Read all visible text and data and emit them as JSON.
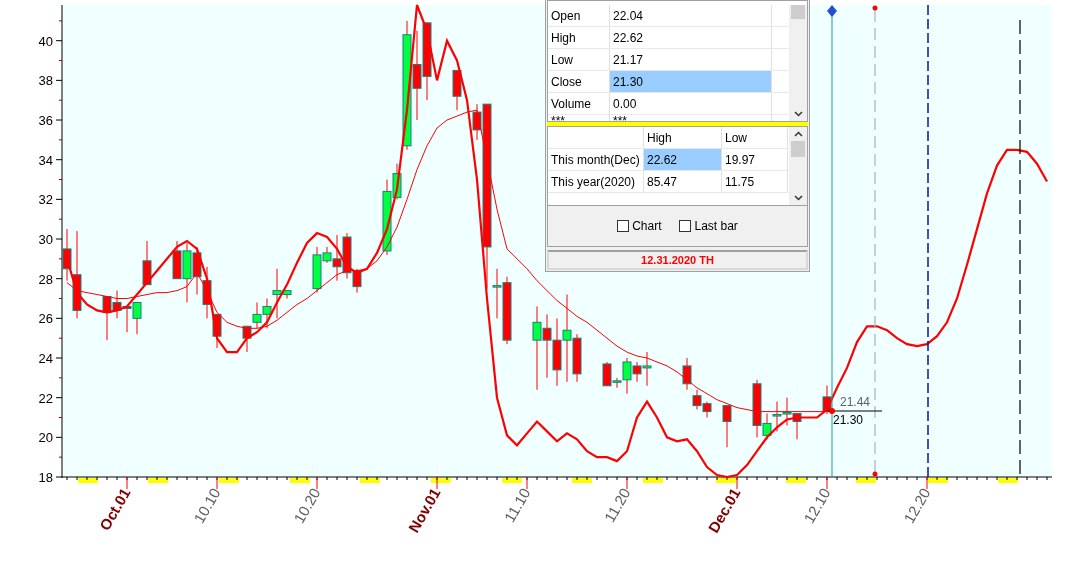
{
  "chart": {
    "chart_data": {
      "type": "candlestick",
      "ylim": [
        18,
        41.8
      ],
      "yticks": [
        18,
        20,
        22,
        24,
        26,
        28,
        30,
        32,
        34,
        36,
        38,
        40
      ],
      "categories": [
        null,
        null,
        null,
        null,
        null,
        null,
        "Oct.01",
        null,
        null,
        null,
        null,
        null,
        null,
        null,
        null,
        "10.10",
        null,
        null,
        null,
        null,
        null,
        null,
        null,
        null,
        null,
        "10.20",
        null,
        null,
        null,
        null,
        null,
        null,
        null,
        null,
        null,
        null,
        null,
        "Nov.01",
        null,
        null,
        null,
        null,
        null,
        null,
        null,
        null,
        "11.10",
        null,
        null,
        null,
        null,
        null,
        null,
        null,
        null,
        null,
        "11.20",
        null,
        null,
        null,
        null,
        null,
        null,
        null,
        null,
        null,
        null,
        "Dec.01",
        null,
        null,
        null,
        null,
        null,
        null,
        null,
        null,
        "12.10",
        null,
        null,
        null,
        null,
        null,
        null,
        null,
        null,
        null,
        "12.20",
        null,
        null,
        null,
        null,
        null,
        null,
        null,
        null,
        null,
        null,
        null,
        null
      ],
      "ohlc": [
        [
          29.5,
          30.5,
          27.9,
          28.5
        ],
        [
          28.2,
          30.4,
          26,
          26.4
        ],
        null,
        null,
        [
          27.1,
          27.1,
          24.9,
          26.3
        ],
        [
          26.8,
          27.4,
          26,
          26.4
        ],
        [
          26.6,
          26.6,
          25.3,
          26.5
        ],
        [
          26,
          26.8,
          25.2,
          26.8
        ],
        [
          28.9,
          29.9,
          27.7,
          27.7
        ],
        null,
        null,
        [
          29.4,
          29.9,
          28,
          28
        ],
        [
          28,
          29.8,
          26.8,
          29.4
        ],
        [
          29.3,
          29.6,
          27.2,
          28.1
        ],
        [
          27.9,
          28.6,
          26,
          26.7
        ],
        [
          26.2,
          26.2,
          24.5,
          25.1
        ],
        null,
        null,
        [
          25.6,
          25.6,
          24.3,
          25
        ],
        [
          25.8,
          26.8,
          25.5,
          26.2
        ],
        [
          26.2,
          27,
          25.5,
          26.6
        ],
        [
          27.2,
          28.5,
          26,
          27.4
        ],
        [
          27.2,
          27.4,
          27,
          27.4
        ],
        null,
        null,
        [
          27.5,
          29.6,
          27.3,
          29.2
        ],
        [
          28.9,
          29.6,
          28.8,
          29.3
        ],
        [
          29,
          30.2,
          27.9,
          28.6
        ],
        [
          30.1,
          30.3,
          28,
          28.3
        ],
        [
          28.4,
          28.5,
          27.3,
          27.6
        ],
        null,
        null,
        [
          29.4,
          33,
          29.2,
          32.4
        ],
        [
          32.1,
          33.8,
          32,
          33.3
        ],
        [
          34.7,
          41,
          34.5,
          40.3
        ],
        [
          38.8,
          40.5,
          36,
          37.6
        ],
        [
          40.9,
          40.9,
          37,
          38.2
        ],
        null,
        null,
        [
          38.5,
          38.5,
          36.5,
          37.2
        ],
        null,
        [
          36.4,
          36.8,
          35,
          35.5
        ],
        [
          36.8,
          36.8,
          27.5,
          29.6
        ],
        [
          27.6,
          28.5,
          26,
          27.65
        ],
        [
          27.8,
          28.1,
          24.7,
          24.9
        ],
        null,
        null,
        [
          24.9,
          26.6,
          22.4,
          25.8
        ],
        [
          25.5,
          26.2,
          23,
          24.9
        ],
        [
          24.9,
          26,
          22.6,
          23.4
        ],
        [
          24.9,
          27.2,
          22.8,
          25.4
        ],
        [
          25,
          25.2,
          22.8,
          23.2
        ],
        null,
        null,
        [
          23.7,
          23.8,
          22.6,
          22.6
        ],
        [
          22.8,
          23,
          22.5,
          22.85
        ],
        [
          22.9,
          24,
          22.2,
          23.8
        ],
        [
          23.6,
          23.8,
          22.8,
          23.2
        ],
        [
          23.5,
          24.3,
          22.6,
          23.6
        ],
        null,
        null,
        null,
        [
          23.6,
          24,
          22.4,
          22.7
        ],
        [
          22.1,
          22.4,
          21.4,
          21.6
        ],
        [
          21.7,
          21.8,
          21,
          21.3
        ],
        null,
        [
          21.6,
          21.6,
          19.5,
          20.8
        ],
        null,
        null,
        [
          22.7,
          22.9,
          20,
          20.6
        ],
        [
          20.1,
          21.2,
          19.9,
          20.7
        ],
        [
          21.1,
          21.8,
          20.3,
          21.15
        ],
        [
          21.2,
          22,
          20.6,
          21.25
        ],
        [
          21.2,
          21.2,
          19.9,
          20.8
        ],
        null,
        null,
        [
          22.04,
          22.62,
          21.17,
          21.3
        ],
        null,
        null,
        null,
        null,
        null,
        null,
        null,
        null,
        null,
        null,
        null,
        null,
        null,
        null,
        null,
        null,
        null,
        null,
        null,
        null,
        null,
        null
      ],
      "series": [
        {
          "type": "line",
          "color": "#ff0000",
          "values": [
            29.0,
            27.3,
            26.7,
            26.4,
            26.3,
            26.4,
            26.6,
            27.2,
            27.8,
            28.4,
            29.0,
            29.6,
            29.9,
            29.5,
            28.0,
            25.0,
            24.3,
            24.3,
            25.0,
            25.3,
            25.8,
            26.8,
            27.7,
            28.8,
            29.8,
            30.3,
            30.1,
            29.5,
            28.6,
            28.3,
            28.5,
            29.3,
            30.5,
            32.5,
            36.5,
            41.8,
            40.5,
            38.0,
            40.0,
            39.0,
            37.0,
            33.0,
            27.0,
            22.0,
            20.1,
            19.6,
            20.2,
            20.8,
            20.3,
            19.8,
            20.2,
            19.9,
            19.3,
            19.0,
            19.0,
            18.8,
            19.3,
            21.0,
            21.8,
            21.0,
            20.0,
            19.8,
            19.9,
            19.3,
            18.5,
            18.1,
            18.0,
            18.1,
            18.6,
            19.3,
            20.0,
            20.5,
            20.9,
            21.0,
            21.0,
            21.0,
            21.4,
            22.5,
            23.5,
            24.8,
            25.6,
            25.6,
            25.4,
            25.0,
            24.7,
            24.6,
            24.7,
            25.1,
            25.8,
            27.0,
            28.7,
            30.5,
            32.3,
            33.7,
            34.5,
            34.5,
            34.4,
            33.8,
            32.9
          ]
        },
        {
          "type": "line",
          "color": "#ff0000",
          "values": [
            27.8,
            27.4,
            27.3,
            27.2,
            27.1,
            27.0,
            27.0,
            27.1,
            27.2,
            27.3,
            27.3,
            27.4,
            27.6,
            28.3,
            27.4,
            26.3,
            25.8,
            25.6,
            25.5,
            25.5,
            25.6,
            25.9,
            26.3,
            26.7,
            27.0,
            27.4,
            27.8,
            28.2,
            28.4,
            28.4,
            28.5,
            28.9,
            29.6,
            30.6,
            32.0,
            33.5,
            34.7,
            35.6,
            36.0,
            36.2,
            36.4,
            36.5,
            34.0,
            31.5,
            29.5,
            29.0,
            28.5,
            27.9,
            27.4,
            26.9,
            26.5,
            26.1,
            25.8,
            25.4,
            25.0,
            24.6,
            24.3,
            24.1,
            24.0,
            23.8,
            23.6,
            23.3,
            22.9,
            22.5,
            22.2,
            21.9,
            21.7,
            21.5,
            21.4,
            21.3,
            21.3,
            21.3,
            21.3,
            21.3,
            21.3,
            21.3,
            21.3,
            null,
            null,
            null,
            null,
            null,
            null,
            null,
            null,
            null,
            null,
            null,
            null,
            null,
            null,
            null,
            null,
            null,
            null,
            null,
            null,
            null,
            null
          ]
        }
      ]
    },
    "x_label_styles": [
      {
        "emphasized": true
      },
      {
        "emphasized": false
      },
      {
        "emphasized": false
      },
      {
        "emphasized": true
      },
      {
        "emphasized": false
      },
      {
        "emphasized": false
      },
      {
        "emphasized": true
      },
      {
        "emphasized": false
      },
      {
        "emphasized": false
      }
    ],
    "price_labels": [
      "21.44",
      "21.30"
    ]
  },
  "info_panel": {
    "quote_rows": [
      {
        "label": "Open",
        "value": "22.04",
        "selected": false
      },
      {
        "label": "High",
        "value": "22.62",
        "selected": false
      },
      {
        "label": "Low",
        "value": "21.17",
        "selected": false
      },
      {
        "label": "Close",
        "value": "21.30",
        "selected": true
      },
      {
        "label": "Volume",
        "value": "0.00",
        "selected": false
      },
      {
        "label": "***",
        "value": "***",
        "selected": false
      }
    ],
    "range_table": {
      "columns": [
        "High",
        "Low"
      ],
      "rows": [
        {
          "label": "This month(Dec)",
          "cells": [
            {
              "value": "22.62",
              "selected": true
            },
            {
              "value": "19.97",
              "selected": false
            }
          ]
        },
        {
          "label": "This year(2020)",
          "cells": [
            {
              "value": "85.47",
              "selected": false
            },
            {
              "value": "11.75",
              "selected": false
            }
          ]
        }
      ]
    },
    "checkboxes": [
      {
        "label": "Chart",
        "checked": false
      },
      {
        "label": "Last bar",
        "checked": false
      }
    ],
    "status": "12.31.2020 TH"
  }
}
